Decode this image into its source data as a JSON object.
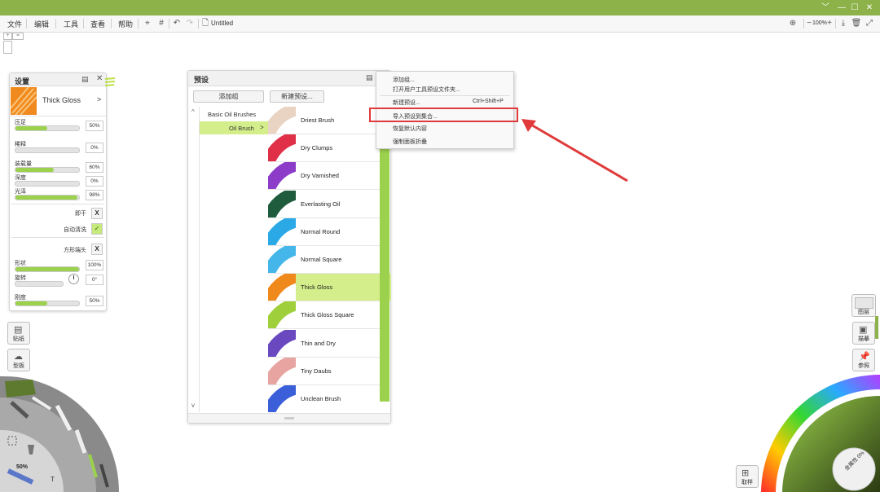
{
  "titlebar": {
    "color": "#8db24a",
    "win_minimize": "﹀",
    "win_min": "—",
    "win_max": "☐",
    "win_close": "✕"
  },
  "menubar": {
    "menus": [
      "文件",
      "编辑",
      "工具",
      "查看",
      "帮助"
    ],
    "document_title": "Untitled",
    "zoom": "100%",
    "zoom_minus": "−",
    "zoom_plus": "+"
  },
  "settings_panel": {
    "title": "设置",
    "brush_name": "Thick Gloss",
    "params": [
      {
        "label": "压足",
        "value": "50%",
        "level": 0.5
      },
      {
        "label": "稀释",
        "value": "0%",
        "level": 0.0
      },
      {
        "label": "装载量",
        "value": "60%",
        "level": 0.6
      },
      {
        "label": "深度",
        "value": "0%",
        "level": 0.0
      },
      {
        "label": "光泽",
        "value": "98%",
        "level": 0.98
      }
    ],
    "instant_dry": "即干",
    "instant_dry_state": "X",
    "auto_clean": "自动清洗",
    "auto_clean_state": "✓",
    "square_head": "方形端头",
    "square_head_state": "X",
    "shape": {
      "label": "形状",
      "value": "100%",
      "level": 1.0
    },
    "rotation": {
      "label": "旋转",
      "value": "0°",
      "level": 0.0
    },
    "softness": {
      "label": "刚度",
      "value": "50%",
      "level": 0.5
    }
  },
  "left_tools": {
    "sticker": "贴纸",
    "stencil": "型板",
    "zoom_readout": "50%",
    "tool_letters": [
      "T"
    ]
  },
  "presets_panel": {
    "title": "预设",
    "add_group": "添加组",
    "new_preset": "新建预设...",
    "groups": [
      "Basic Oil Brushes",
      "Oil Brush"
    ],
    "selected_group": "Oil Brush",
    "brushes": [
      {
        "name": "Driest Brush",
        "color": "#e9d3c2"
      },
      {
        "name": "Dry Clumps",
        "color": "#e03048"
      },
      {
        "name": "Dry Varnished",
        "color": "#8c3cc8"
      },
      {
        "name": "Everlasting Oil",
        "color": "#1f5c3e"
      },
      {
        "name": "Normal Round",
        "color": "#2aa9e6"
      },
      {
        "name": "Normal Square",
        "color": "#45b6ea"
      },
      {
        "name": "Thick Gloss",
        "color": "#f0891c"
      },
      {
        "name": "Thick Gloss Square",
        "color": "#9fd03c"
      },
      {
        "name": "Thin and Dry",
        "color": "#6a48c0"
      },
      {
        "name": "Tiny Daubs",
        "color": "#e8a4a0"
      },
      {
        "name": "Unclean Brush",
        "color": "#3a5fd8"
      }
    ],
    "selected_brush": "Thick Gloss",
    "scroll_up": "^",
    "scroll_down": "v"
  },
  "context_menu": {
    "items": [
      {
        "label": "添加组...",
        "shortcut": ""
      },
      {
        "label": "打开用户工具预设文件夹...",
        "shortcut": ""
      },
      {
        "label": "新建预设...",
        "shortcut": "Ctrl+Shift+P"
      },
      {
        "label": "导入预设到集合...",
        "shortcut": ""
      },
      {
        "label": "恢复默认内容",
        "shortcut": ""
      },
      {
        "label": "强制面板折叠",
        "shortcut": ""
      }
    ],
    "highlighted_item": "导入预设到集合...",
    "highlight_color": "#e03a3a"
  },
  "right_tools": {
    "layers": "图层",
    "tracing": "描摹",
    "reference": "参照",
    "sample": "取样",
    "color_readout": "金属性 0%"
  },
  "accent_colors": {
    "green": "#9bd14c",
    "selected_row": "#d3ee8a",
    "arrow": "#e03a3a"
  }
}
